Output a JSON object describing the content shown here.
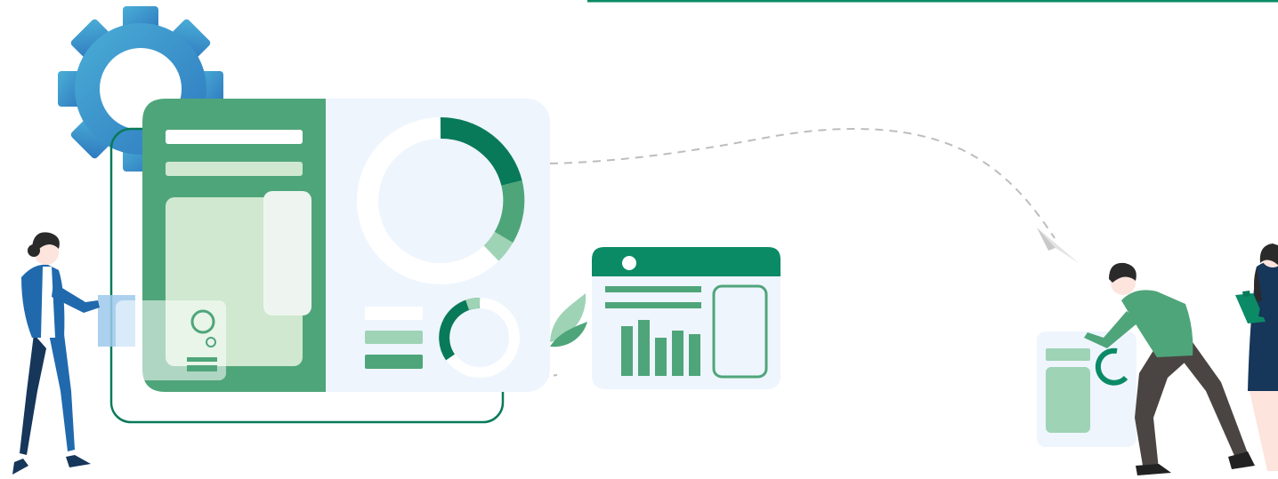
{
  "illustration": {
    "subject": "dashboard-analytics-teamwork",
    "colors": {
      "primary_green": "#4fa57a",
      "dark_green": "#0b8a66",
      "deep_green": "#087a5a",
      "light_green": "#cfe8cf",
      "pale_green": "#9ed3b5",
      "panel_bg": "#eef5fd",
      "gear_blue_light": "#4aaed6",
      "gear_blue_dark": "#2e78bf",
      "suit_blue": "#2069ad",
      "navy": "#16365a",
      "trouser_dark": "#4a4542",
      "skin": "#fde4dc",
      "hair": "#2a2a2a",
      "dash_gray": "#bdbdbd",
      "top_line": "#0b8a66"
    },
    "icons": [
      "gear-icon",
      "donut-chart-icon",
      "bar-chart-icon",
      "paper-plane-icon",
      "leaf-icon",
      "clipboard-icon"
    ]
  }
}
